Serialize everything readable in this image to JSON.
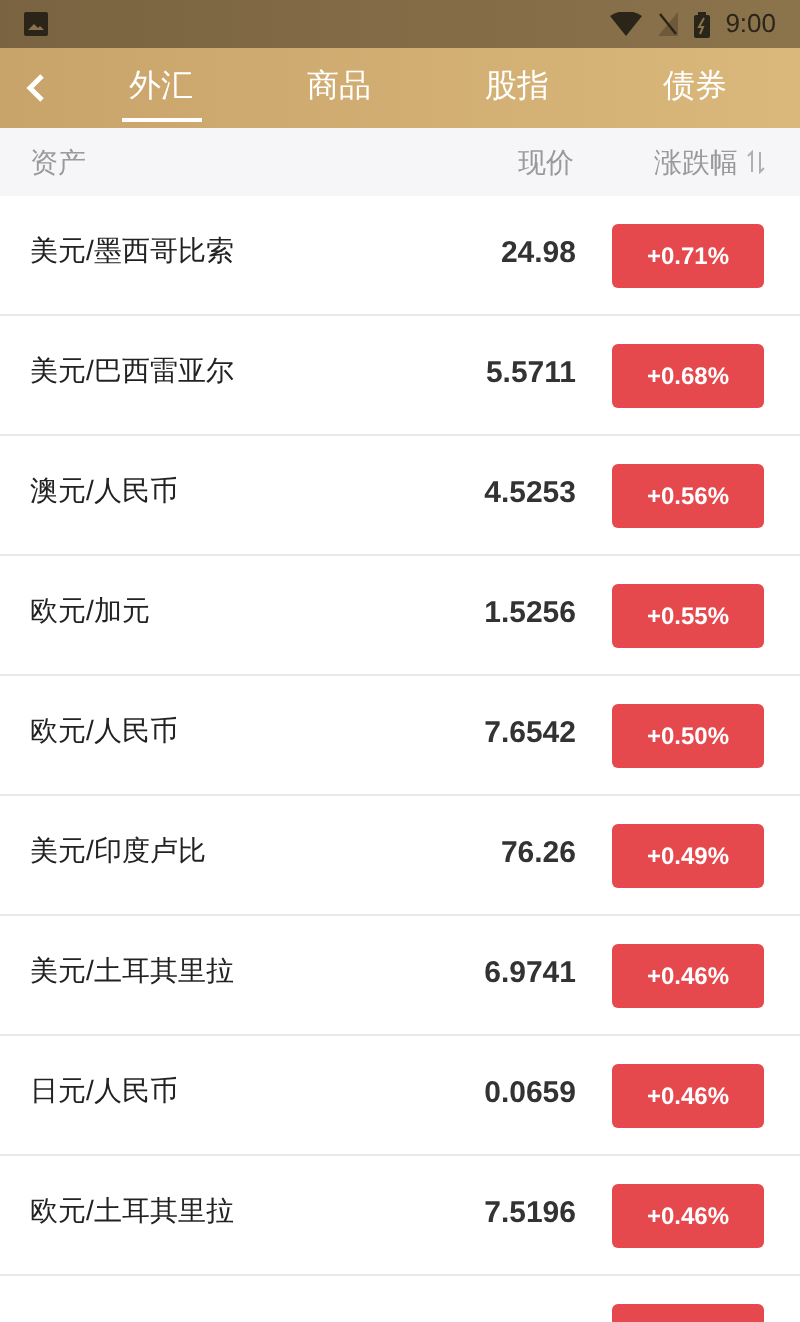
{
  "status_bar": {
    "time": "9:00"
  },
  "tabs": [
    {
      "label": "外汇",
      "selected": true
    },
    {
      "label": "商品",
      "selected": false
    },
    {
      "label": "股指",
      "selected": false
    },
    {
      "label": "债券",
      "selected": false
    }
  ],
  "table": {
    "columns": [
      "资产",
      "现价",
      "涨跌幅"
    ],
    "rows": [
      {
        "asset": "美元/墨西哥比索",
        "price": "24.98",
        "change": "+0.71%",
        "color": "#e5484d"
      },
      {
        "asset": "美元/巴西雷亚尔",
        "price": "5.5711",
        "change": "+0.68%",
        "color": "#e5484d"
      },
      {
        "asset": "澳元/人民币",
        "price": "4.5253",
        "change": "+0.56%",
        "color": "#e5484d"
      },
      {
        "asset": "欧元/加元",
        "price": "1.5256",
        "change": "+0.55%",
        "color": "#e5484d"
      },
      {
        "asset": "欧元/人民币",
        "price": "7.6542",
        "change": "+0.50%",
        "color": "#e5484d"
      },
      {
        "asset": "美元/印度卢比",
        "price": "76.26",
        "change": "+0.49%",
        "color": "#e5484d"
      },
      {
        "asset": "美元/土耳其里拉",
        "price": "6.9741",
        "change": "+0.46%",
        "color": "#e5484d"
      },
      {
        "asset": "日元/人民币",
        "price": "0.0659",
        "change": "+0.46%",
        "color": "#e5484d"
      },
      {
        "asset": "欧元/土耳其里拉",
        "price": "7.5196",
        "change": "+0.46%",
        "color": "#e5484d"
      }
    ],
    "partial_row": {
      "color": "#e5484d"
    }
  }
}
